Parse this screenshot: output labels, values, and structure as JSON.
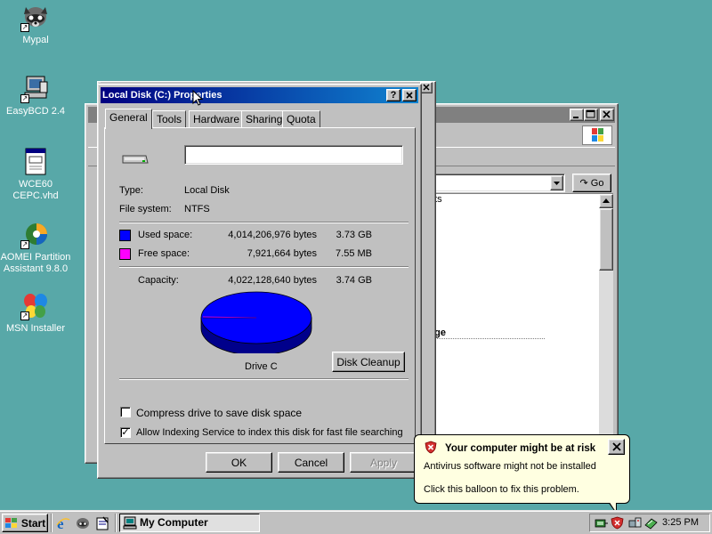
{
  "desktop": {
    "icons": [
      {
        "label": "Mypal",
        "icon": "raccoon-app-icon"
      },
      {
        "label": "EasyBCD 2.4",
        "icon": "computer-tool-icon"
      },
      {
        "label": "WCE60 CEPC.vhd",
        "icon": "document-icon"
      },
      {
        "label": "AOMEI Partition Assistant 9.8.0",
        "icon": "partition-tool-icon"
      },
      {
        "label": "MSN Installer",
        "icon": "butterfly-icon"
      }
    ]
  },
  "explorer": {
    "go_label": "Go",
    "content_frag_1": "nts",
    "content_frag_2": "age"
  },
  "dialog": {
    "title": "Local Disk (C:) Properties",
    "tabs": [
      "General",
      "Tools",
      "Hardware",
      "Sharing",
      "Quota"
    ],
    "active_tab": "General",
    "label_value": "",
    "type_label": "Type:",
    "type_value": "Local Disk",
    "fs_label": "File system:",
    "fs_value": "NTFS",
    "used_label": "Used space:",
    "used_bytes": "4,014,206,976 bytes",
    "used_size": "3.73 GB",
    "free_label": "Free space:",
    "free_bytes": "7,921,664 bytes",
    "free_size": "7.55 MB",
    "capacity_label": "Capacity:",
    "capacity_bytes": "4,022,128,640 bytes",
    "capacity_size": "3.74 GB",
    "drive_label": "Drive C",
    "disk_cleanup": "Disk Cleanup",
    "compress_label": "Compress drive to save disk space",
    "compress_checked": false,
    "index_label": "Allow Indexing Service to index this disk for fast file searching",
    "index_checked": true,
    "ok": "OK",
    "cancel": "Cancel",
    "apply": "Apply",
    "help_glyph": "?",
    "close_glyph": "×",
    "colors": {
      "used": "#0000ff",
      "free": "#ff00ff",
      "title_start": "#000080",
      "title_end": "#1084d0"
    }
  },
  "balloon": {
    "title": "Your computer might be at risk",
    "line1": "Antivirus software might not be installed",
    "line2": "Click this balloon to fix this problem."
  },
  "taskbar": {
    "start_label": "Start",
    "task_label": "My Computer",
    "clock": "3:25 PM"
  }
}
